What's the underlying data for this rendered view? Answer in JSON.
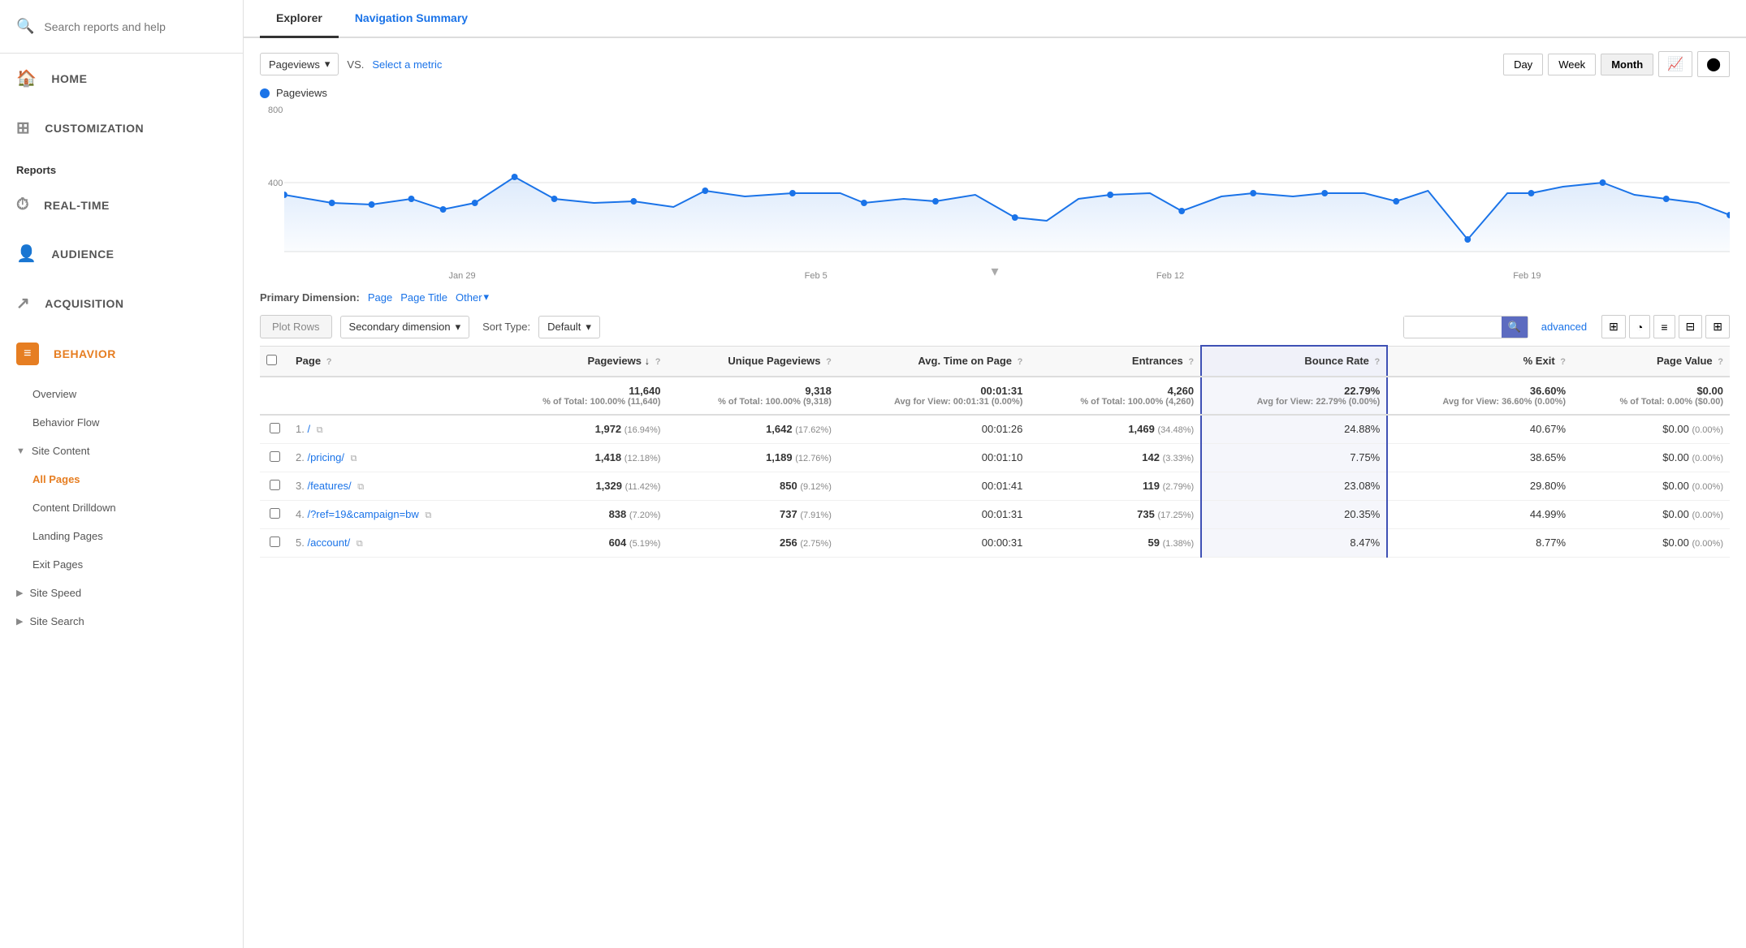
{
  "sidebar": {
    "search_placeholder": "Search reports and help",
    "nav_items": [
      {
        "id": "home",
        "label": "HOME",
        "icon": "🏠"
      },
      {
        "id": "customization",
        "label": "CUSTOMIZATION",
        "icon": "⊞"
      }
    ],
    "reports_label": "Reports",
    "report_nav": [
      {
        "id": "realtime",
        "label": "REAL-TIME",
        "icon": "⏱"
      },
      {
        "id": "audience",
        "label": "AUDIENCE",
        "icon": "👤"
      },
      {
        "id": "acquisition",
        "label": "ACQUISITION",
        "icon": "↗"
      },
      {
        "id": "behavior",
        "label": "BEHAVIOR",
        "icon": "≡",
        "active": true
      }
    ],
    "behavior_sub": [
      {
        "id": "overview",
        "label": "Overview",
        "active": false
      },
      {
        "id": "behavior-flow",
        "label": "Behavior Flow",
        "active": false
      },
      {
        "id": "site-content-group",
        "label": "Site Content",
        "expandable": true
      },
      {
        "id": "all-pages",
        "label": "All Pages",
        "active": true
      },
      {
        "id": "content-drilldown",
        "label": "Content Drilldown",
        "active": false
      },
      {
        "id": "landing-pages",
        "label": "Landing Pages",
        "active": false
      },
      {
        "id": "exit-pages",
        "label": "Exit Pages",
        "active": false
      },
      {
        "id": "site-speed",
        "label": "Site Speed",
        "expandable": true
      },
      {
        "id": "site-search",
        "label": "Site Search",
        "expandable": true
      }
    ]
  },
  "tabs": [
    {
      "id": "explorer",
      "label": "Explorer",
      "active": true
    },
    {
      "id": "navigation-summary",
      "label": "Navigation Summary",
      "active": false
    }
  ],
  "chart": {
    "metric_label": "Pageviews",
    "vs_label": "VS.",
    "select_metric_label": "Select a metric",
    "y_label": "800",
    "y_label2": "400",
    "x_labels": [
      "Jan 29",
      "Feb 5",
      "Feb 12",
      "Feb 19"
    ],
    "date_buttons": [
      "Day",
      "Week",
      "Month"
    ],
    "active_date_btn": "Month",
    "chart_type_icons": [
      "📈",
      "⬤"
    ]
  },
  "table": {
    "primary_dimension_label": "Primary Dimension:",
    "dim_options": [
      "Page",
      "Page Title",
      "Other"
    ],
    "plot_rows_label": "Plot Rows",
    "secondary_dim_label": "Secondary dimension",
    "sort_label": "Sort Type:",
    "sort_options": [
      "Default"
    ],
    "search_placeholder": "",
    "advanced_label": "advanced",
    "columns": [
      {
        "id": "page",
        "label": "Page",
        "sub": ""
      },
      {
        "id": "pageviews",
        "label": "Pageviews",
        "sub": "↓",
        "help": true
      },
      {
        "id": "unique-pageviews",
        "label": "Unique Pageviews",
        "sub": "",
        "help": true
      },
      {
        "id": "avg-time",
        "label": "Avg. Time on Page",
        "sub": "",
        "help": true
      },
      {
        "id": "entrances",
        "label": "Entrances",
        "sub": "",
        "help": true
      },
      {
        "id": "bounce-rate",
        "label": "Bounce Rate",
        "sub": "",
        "help": true
      },
      {
        "id": "pct-exit",
        "label": "% Exit",
        "sub": "",
        "help": true
      },
      {
        "id": "page-value",
        "label": "Page Value",
        "sub": "",
        "help": true
      }
    ],
    "totals": {
      "pageviews": "11,640",
      "pageviews_sub": "% of Total: 100.00% (11,640)",
      "unique_pageviews": "9,318",
      "unique_pageviews_sub": "% of Total: 100.00% (9,318)",
      "avg_time": "00:01:31",
      "avg_time_sub": "Avg for View: 00:01:31 (0.00%)",
      "entrances": "4,260",
      "entrances_sub": "% of Total: 100.00% (4,260)",
      "bounce_rate": "22.79%",
      "bounce_rate_sub": "Avg for View: 22.79% (0.00%)",
      "pct_exit": "36.60%",
      "pct_exit_sub": "Avg for View: 36.60% (0.00%)",
      "page_value": "$0.00",
      "page_value_sub": "% of Total: 0.00% ($0.00)"
    },
    "rows": [
      {
        "num": "1.",
        "page": "/",
        "pageviews": "1,972",
        "pageviews_pct": "(16.94%)",
        "unique_pageviews": "1,642",
        "unique_pageviews_pct": "(17.62%)",
        "avg_time": "00:01:26",
        "entrances": "1,469",
        "entrances_pct": "(34.48%)",
        "bounce_rate": "24.88%",
        "pct_exit": "40.67%",
        "page_value": "$0.00",
        "page_value_pct": "(0.00%)"
      },
      {
        "num": "2.",
        "page": "/pricing/",
        "pageviews": "1,418",
        "pageviews_pct": "(12.18%)",
        "unique_pageviews": "1,189",
        "unique_pageviews_pct": "(12.76%)",
        "avg_time": "00:01:10",
        "entrances": "142",
        "entrances_pct": "(3.33%)",
        "bounce_rate": "7.75%",
        "pct_exit": "38.65%",
        "page_value": "$0.00",
        "page_value_pct": "(0.00%)"
      },
      {
        "num": "3.",
        "page": "/features/",
        "pageviews": "1,329",
        "pageviews_pct": "(11.42%)",
        "unique_pageviews": "850",
        "unique_pageviews_pct": "(9.12%)",
        "avg_time": "00:01:41",
        "entrances": "119",
        "entrances_pct": "(2.79%)",
        "bounce_rate": "23.08%",
        "pct_exit": "29.80%",
        "page_value": "$0.00",
        "page_value_pct": "(0.00%)"
      },
      {
        "num": "4.",
        "page": "/?ref=19&campaign=bw",
        "pageviews": "838",
        "pageviews_pct": "(7.20%)",
        "unique_pageviews": "737",
        "unique_pageviews_pct": "(7.91%)",
        "avg_time": "00:01:31",
        "entrances": "735",
        "entrances_pct": "(17.25%)",
        "bounce_rate": "20.35%",
        "pct_exit": "44.99%",
        "page_value": "$0.00",
        "page_value_pct": "(0.00%)"
      },
      {
        "num": "5.",
        "page": "/account/",
        "pageviews": "604",
        "pageviews_pct": "(5.19%)",
        "unique_pageviews": "256",
        "unique_pageviews_pct": "(2.75%)",
        "avg_time": "00:00:31",
        "entrances": "59",
        "entrances_pct": "(1.38%)",
        "bounce_rate": "8.47%",
        "pct_exit": "8.77%",
        "page_value": "$0.00",
        "page_value_pct": "(0.00%)"
      }
    ]
  }
}
